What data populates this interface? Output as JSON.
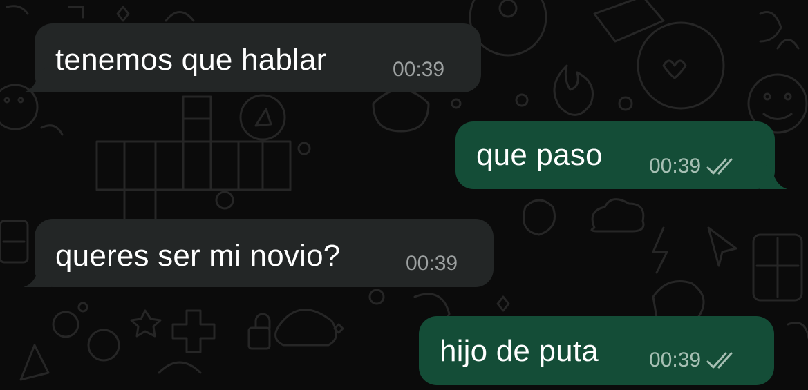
{
  "messages": [
    {
      "direction": "incoming",
      "text": "tenemos que hablar",
      "time": "00:39"
    },
    {
      "direction": "outgoing",
      "text": "que paso",
      "time": "00:39",
      "status_icon": "double-check-icon"
    },
    {
      "direction": "incoming",
      "text": "queres ser mi novio?",
      "time": "00:39"
    },
    {
      "direction": "outgoing",
      "text": "hijo de puta",
      "time": "00:39",
      "status_icon": "double-check-icon"
    }
  ],
  "colors": {
    "background": "#0b0b0b",
    "incoming_bubble": "#232626",
    "outgoing_bubble": "#144d37",
    "text": "#ffffff",
    "incoming_time": "#9da1a1",
    "outgoing_time": "#a6bfb3",
    "wallpaper_doodle": "#2a2a2a"
  }
}
